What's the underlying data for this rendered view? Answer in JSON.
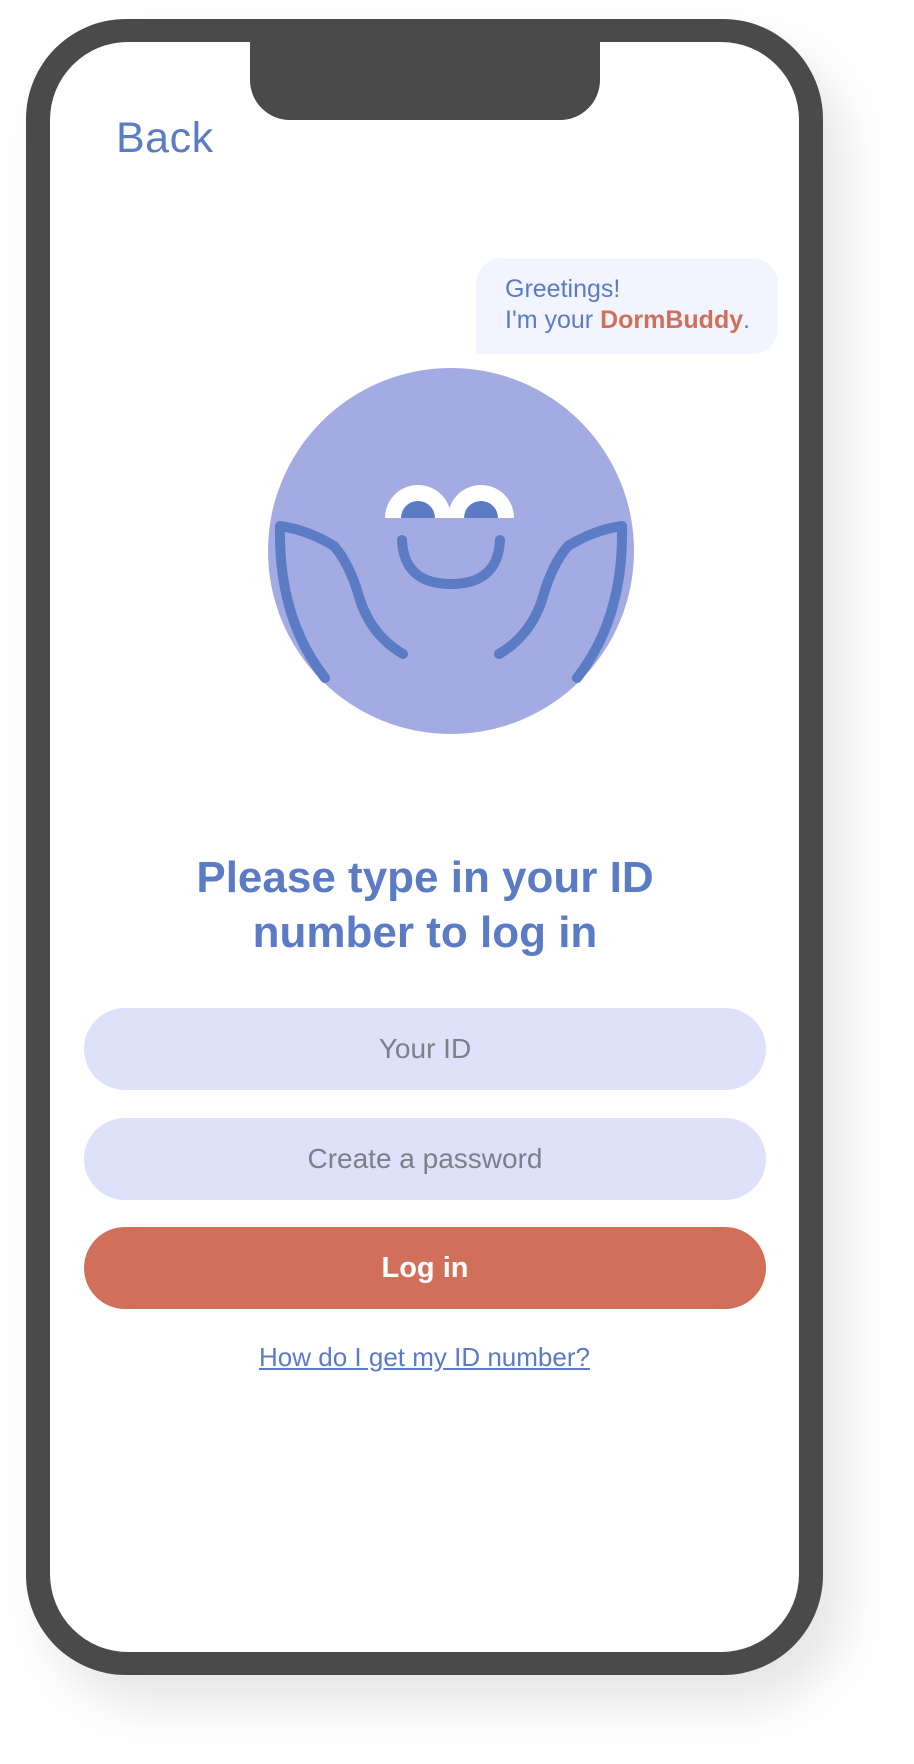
{
  "nav": {
    "back_label": "Back"
  },
  "greeting": {
    "line1": "Greetings!",
    "line2_prefix": "I'm your ",
    "brand": "DormBuddy",
    "line2_suffix": "."
  },
  "mascot": {
    "icon": "smiling-mascot-icon"
  },
  "login": {
    "title_line1": "Please type in your ID",
    "title_line2": "number to log in",
    "id_placeholder": "Your ID",
    "password_placeholder": "Create a password",
    "button_label": "Log in",
    "help_link": "How  do I get my ID number?"
  },
  "colors": {
    "accent_blue": "#5b7bc5",
    "mascot_fill": "#a3abe2",
    "brand_orange": "#d0705b",
    "field_bg": "#dde1fa",
    "bubble_bg": "#f2f4ff"
  }
}
